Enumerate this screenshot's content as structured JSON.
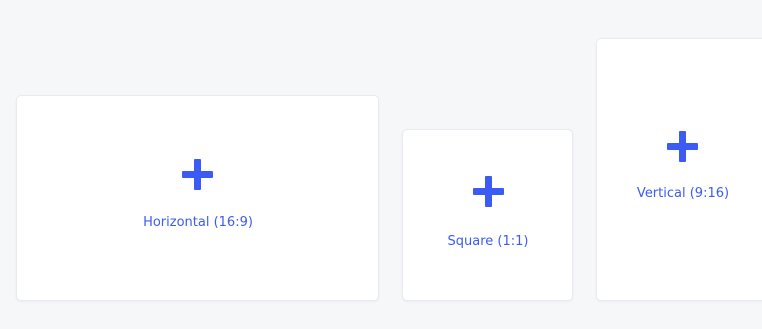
{
  "accent_color": "#3b5bf4",
  "options": [
    {
      "id": "horizontal",
      "label": "Horizontal (16:9)",
      "icon": "plus-icon"
    },
    {
      "id": "square",
      "label": "Square (1:1)",
      "icon": "plus-icon"
    },
    {
      "id": "vertical",
      "label": "Vertical (9:16)",
      "icon": "plus-icon"
    }
  ]
}
